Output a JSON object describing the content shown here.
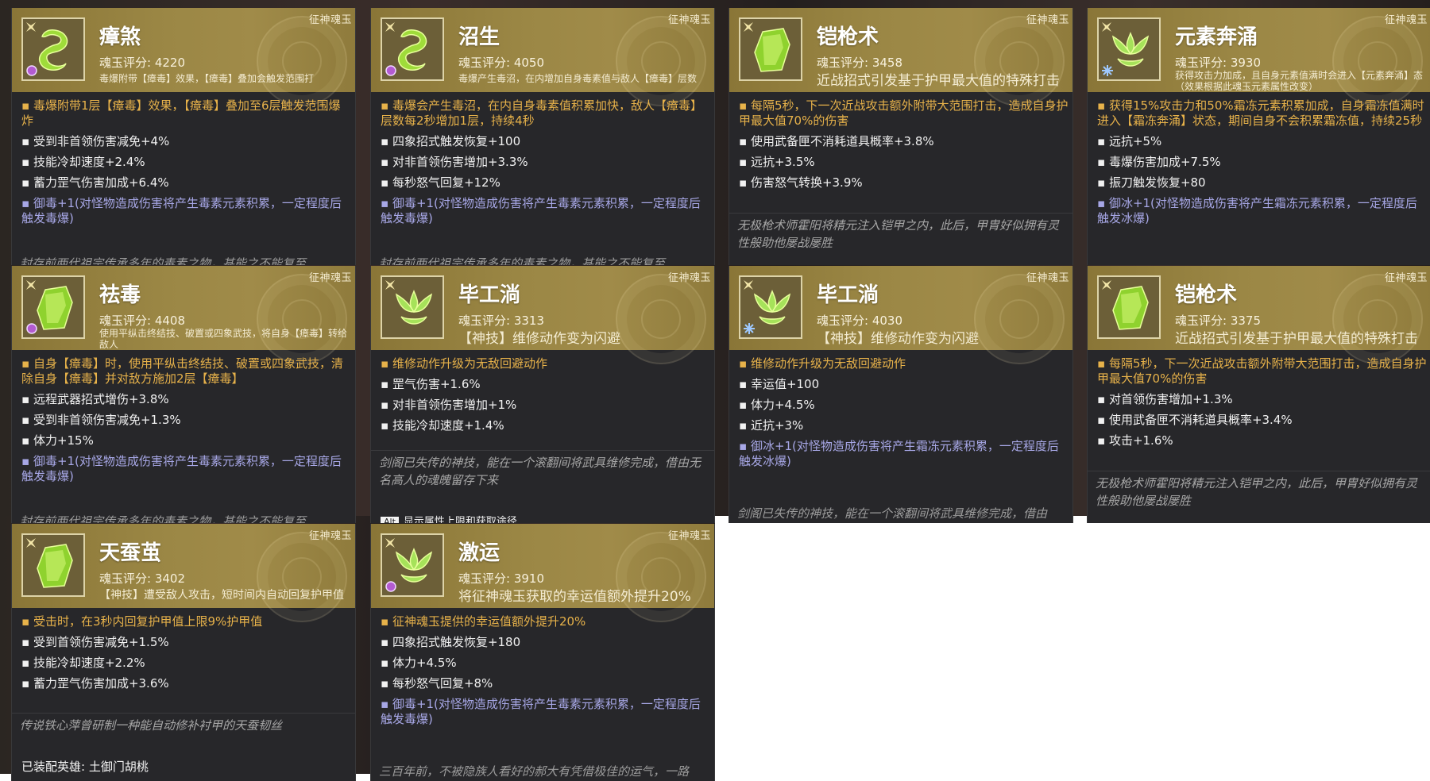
{
  "cards": [
    {
      "badge": "征神魂玉",
      "title": "瘴煞",
      "score": "魂玉评分: 4220",
      "desc": "毒爆附带【瘴毒】效果，【瘴毒】叠加会触发范围打",
      "main": "毒爆附带1层【瘴毒】效果，【瘴毒】叠加至6层触发范围爆炸",
      "stats": [
        "受到非首领伤害减免+4%",
        "技能冷却速度+2.4%",
        "蓄力罡气伤害加成+6.4%"
      ],
      "extra": "御毒+1(对怪物造成伤害将产生毒素元素积累，一定程度后触发毒爆)",
      "flavor_cut": "封存前两代祖宗传承多年的毒素之物，甚能之不能复至"
    },
    {
      "badge": "征神魂玉",
      "title": "沼生",
      "score": "魂玉评分: 4050",
      "desc": "毒爆产生毒沼，在内增加自身毒素值与敌人【瘴毒】层数",
      "main": "毒爆会产生毒沼，在内自身毒素值积累加快，敌人【瘴毒】层数每2秒增加1层，持续4秒",
      "stats": [
        "四象招式触发恢复+100",
        "对非首领伤害增加+3.3%",
        "每秒怒气回复+12%"
      ],
      "extra": "御毒+1(对怪物造成伤害将产生毒素元素积累，一定程度后触发毒爆)",
      "flavor_cut": "封存前两代祖宗传承多年的毒素之物，甚能之不能复至"
    },
    {
      "badge": "征神魂玉",
      "title": "铠枪术",
      "score": "魂玉评分: 3458",
      "desc": "近战招式引发基于护甲最大值的特殊打击",
      "main": "每隔5秒，下一次近战攻击额外附带大范围打击，造成自身护甲最大值70%的伤害",
      "stats": [
        "使用武备匣不消耗道具概率+3.8%",
        "远抗+3.5%",
        "伤害怒气转换+3.9%"
      ],
      "flavor": "无极枪术师霍阳将精元注入铠甲之内，此后，甲胄好似拥有灵性般助他屡战屡胜"
    },
    {
      "badge": "征神魂玉",
      "title": "元素奔涌",
      "score": "魂玉评分: 3930",
      "desc": "获得攻击力加成，且自身元素值满时会进入【元素奔涌】态（效果根据此魂玉元素属性改变）",
      "main": "获得15%攻击力和50%霜冻元素积累加成，自身霜冻值满时进入【霜冻奔涌】状态，期间自身不会积累霜冻值，持续25秒",
      "stats": [
        "远抗+5%",
        "毒爆伤害加成+7.5%",
        "振刀触发恢复+80"
      ],
      "extra": "御冰+1(对怪物造成伤害将产生霜冻元素积累，一定程度后触发冰爆)"
    },
    {
      "badge": "征神魂玉",
      "title": "祛毒",
      "score": "魂玉评分: 4408",
      "desc": "使用平纵击终结技、破置或四象武技，将自身【瘴毒】转给敌人",
      "main": "自身【瘴毒】时，使用平纵击终结技、破置或四象武技，清除自身【瘴毒】并对敌方施加2层【瘴毒】",
      "stats": [
        "远程武器招式增伤+3.8%",
        "受到非首领伤害减免+1.3%",
        "体力+15%"
      ],
      "extra": "御毒+1(对怪物造成伤害将产生毒素元素积累，一定程度后触发毒爆)",
      "flavor_cut": "封存前两代祖宗传承多年的毒素之物，甚能之不能复至"
    },
    {
      "badge": "征神魂玉",
      "title": "毕工淌",
      "score": "魂玉评分: 3313",
      "desc": "【神技】维修动作变为闪避",
      "main": "维修动作升级为无敌回避动作",
      "stats": [
        "罡气伤害+1.6%",
        "对非首领伤害增加+1%",
        "技能冷却速度+1.4%"
      ],
      "flavor": "剑阁已失传的神技，能在一个滚翻间将武具维修完成，借由无名高人的魂魄留存下来",
      "tip_key": "Alt",
      "tip_text": "显示属性上限和获取途径"
    },
    {
      "badge": "征神魂玉",
      "title": "毕工淌",
      "score": "魂玉评分: 4030",
      "desc": "【神技】维修动作变为闪避",
      "main": "维修动作升级为无敌回避动作",
      "stats": [
        "幸运值+100",
        "体力+4.5%",
        "近抗+3%"
      ],
      "extra": "御冰+1(对怪物造成伤害将产生霜冻元素积累，一定程度后触发冰爆)",
      "flavor_cut": "剑阁已失传的神技，能在一个滚翻间将武具维修完成，借由"
    },
    {
      "badge": "征神魂玉",
      "title": "铠枪术",
      "score": "魂玉评分: 3375",
      "desc": "近战招式引发基于护甲最大值的特殊打击",
      "main": "每隔5秒，下一次近战攻击额外附带大范围打击，造成自身护甲最大值70%的伤害",
      "stats": [
        "对首领伤害增加+1.3%",
        "使用武备匣不消耗道具概率+3.4%",
        "攻击+1.6%"
      ],
      "flavor": "无极枪术师霍阳将精元注入铠甲之内，此后，甲胄好似拥有灵性般助他屡战屡胜"
    },
    {
      "badge": "征神魂玉",
      "title": "天蚕茧",
      "score": "魂玉评分: 3402",
      "desc": "【神技】遭受敌人攻击，短时间内自动回复护甲值",
      "main": "受击时，在3秒内回复护甲值上限9%护甲值",
      "stats": [
        "受到首领伤害减免+1.5%",
        "技能冷却速度+2.2%",
        "蓄力罡气伤害加成+3.6%"
      ],
      "flavor": "传说铁心萍曾研制一种能自动修补衬甲的天蚕韧丝",
      "hero": "已装配英雄: 土御门胡桃"
    },
    {
      "badge": "征神魂玉",
      "title": "激运",
      "score": "魂玉评分: 3910",
      "desc": "将征神魂玉获取的幸运值额外提升20%",
      "main": "征神魂玉提供的幸运值额外提升20%",
      "stats": [
        "四象招式触发恢复+180",
        "体力+4.5%",
        "每秒怒气回复+8%"
      ],
      "extra": "御毒+1(对怪物造成伤害将产生毒素元素积累，一定程度后触发毒爆)",
      "flavor_cut": "三百年前，不被隐族人看好的郝大有凭借极佳的运气，一路"
    }
  ],
  "colors": {
    "header_gold": "#9b8745",
    "panel_dark": "#27272a",
    "main_effect": "#e7b24a",
    "element_extra": "#a7a7e6",
    "flavor_text": "#a6a6a6"
  }
}
